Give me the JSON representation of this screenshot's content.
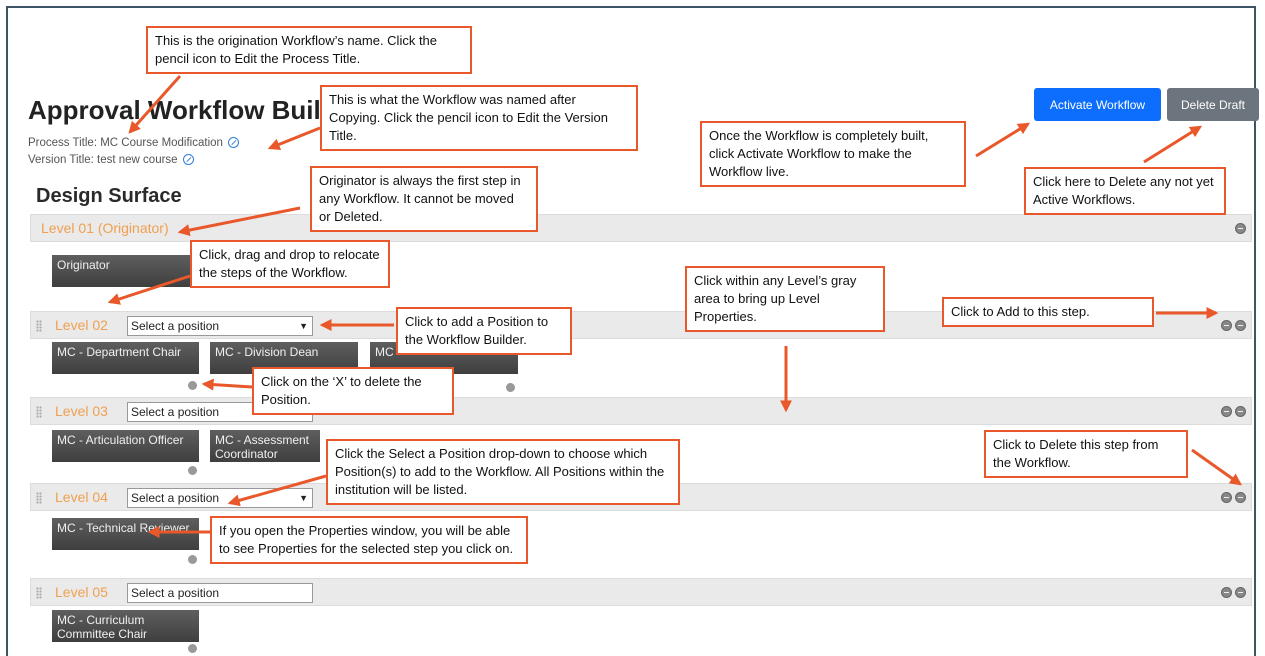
{
  "page": {
    "title": "Approval Workflow Builder",
    "process_title": "Process Title: MC Course Modification",
    "version_title": "Version Title: test new course",
    "design_surface": "Design Surface"
  },
  "toolbar": {
    "activate_label": "Activate Workflow",
    "delete_label": "Delete Draft"
  },
  "levels": [
    {
      "label": "Level 01 (Originator)"
    },
    {
      "label": "Level 02",
      "select_value": "Select a position"
    },
    {
      "label": "Level 03",
      "select_value": "Select a position"
    },
    {
      "label": "Level 04",
      "select_value": "Select a position"
    },
    {
      "label": "Level 05",
      "select_value": "Select a position"
    }
  ],
  "steps": {
    "originator": "Originator",
    "dept_chair": "MC - Department Chair",
    "division_dean": "MC - Division Dean",
    "mc": "MC",
    "articulation": "MC - Articulation Officer",
    "assessment": "MC - Assessment Coordinator",
    "technical": "MC - Technical Reviewer",
    "curriculum": "MC - Curriculum Committee Chair"
  },
  "callouts": {
    "workflow_name": "This is the origination Workflow’s name. Click the pencil icon to Edit the Process Title.",
    "version_title": "This is what the Workflow was named after Copying. Click the pencil icon to Edit the Version Title.",
    "activate": "Once the Workflow is completely built, click Activate Workflow to make the Workflow live.",
    "delete_draft": "Click here to Delete any not yet Active Workflows.",
    "originator": "Originator is always the first step in any Workflow. It cannot be moved or Deleted.",
    "drag_drop": "Click, drag and drop to relocate the steps of the Workflow.",
    "level_properties": "Click within any Level’s gray area to bring up Level Properties.",
    "add_step": "Click to Add to this step.",
    "add_position": "Click to add a Position to the Workflow Builder.",
    "delete_position": "Click on the ‘X’ to delete the Position.",
    "delete_step": "Click to Delete this step from the Workflow.",
    "select_position": "Click the Select a Position drop-down to choose which Position(s) to add to the Workflow. All Positions within the institution  will be listed.",
    "properties_window": "If you open the Properties window, you will be able to see Properties for the selected step you click on."
  },
  "colors": {
    "accent": "#e8582a",
    "level_label": "#f0a050",
    "primary": "#0d6efd",
    "secondary": "#6c757d"
  }
}
